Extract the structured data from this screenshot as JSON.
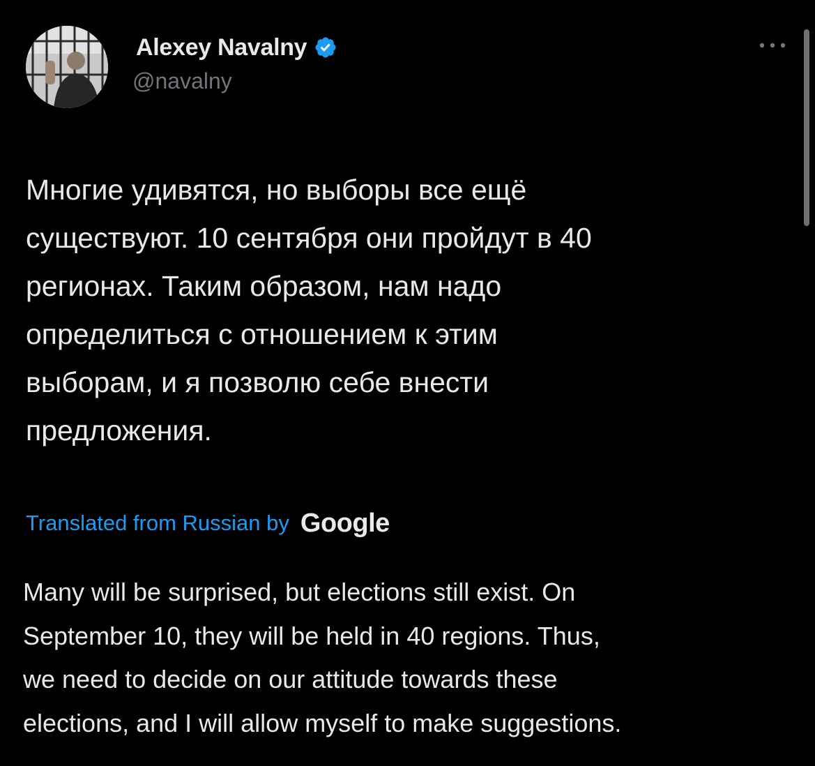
{
  "author": {
    "name": "Alexey Navalny",
    "handle": "@navalny",
    "verified": true,
    "avatar_icon": "profile-photo-icon"
  },
  "colors": {
    "background": "#000000",
    "primary_text": "#e7e9ea",
    "secondary_text": "#71767b",
    "link": "#1d9bf0",
    "verified_badge": "#1d9bf0"
  },
  "tweet": {
    "lines": [
      "Многие удивятся, но выборы все ещё",
      "существуют. 10 сентября они пройдут в 40",
      "регионах. Таким образом, нам надо",
      "определиться с отношением к этим",
      "выборам, и я позволю себе внести",
      "предложения."
    ]
  },
  "translation": {
    "label": "Translated from Russian by",
    "provider": "Google",
    "lines": [
      "Many will be surprised, but elections still exist. On",
      "September 10, they will be held in 40 regions. Thus,",
      "we need to decide on our attitude towards these",
      "elections, and I will allow myself to make suggestions."
    ]
  },
  "menu": {
    "icon": "more-horizontal-icon"
  }
}
